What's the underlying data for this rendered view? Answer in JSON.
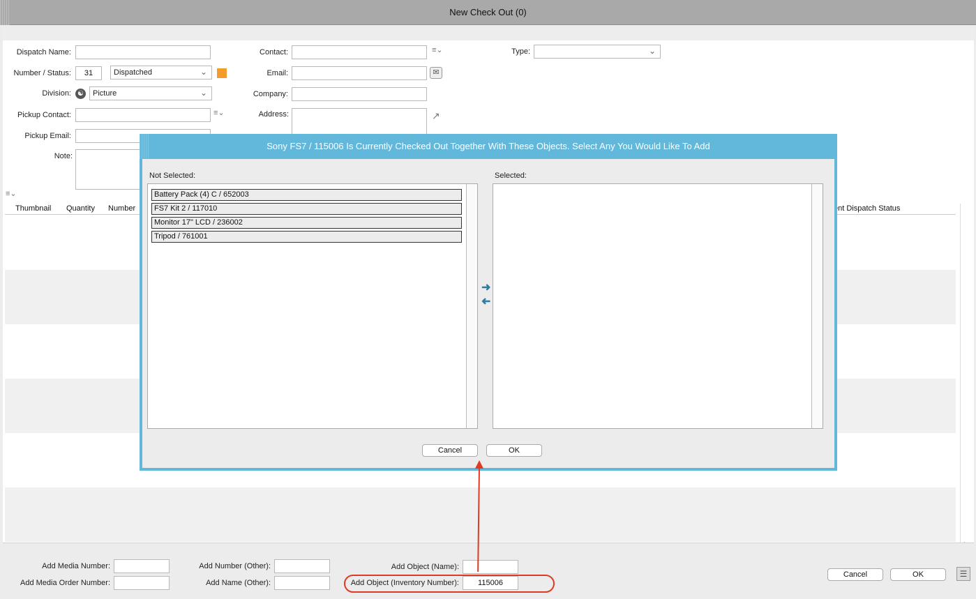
{
  "window": {
    "title": "New Check Out (0)"
  },
  "form": {
    "dispatch_name_label": "Dispatch Name:",
    "dispatch_name_value": "",
    "number_status_label": "Number / Status:",
    "number_value": "31",
    "status_value": "Dispatched",
    "status_color": "#f39c2b",
    "division_label": "Division:",
    "division_value": "Picture",
    "pickup_contact_label": "Pickup Contact:",
    "pickup_email_label": "Pickup Email:",
    "note_label": "Note:",
    "contact_label": "Contact:",
    "email_label": "Email:",
    "company_label": "Company:",
    "address_label": "Address:",
    "type_label": "Type:",
    "type_value": ""
  },
  "grid": {
    "columns": [
      "Thumbnail",
      "Quantity",
      "Number",
      "ent Dispatch Status"
    ]
  },
  "footer": {
    "add_media_number_label": "Add Media Number:",
    "add_media_order_number_label": "Add Media Order Number:",
    "add_number_other_label": "Add Number (Other):",
    "add_name_other_label": "Add Name (Other):",
    "add_object_name_label": "Add Object (Name):",
    "add_object_inventory_label": "Add Object (Inventory Number):",
    "add_object_inventory_value": "115006",
    "cancel_label": "Cancel",
    "ok_label": "OK"
  },
  "modal": {
    "title": "Sony FS7 / 115006 Is Currently Checked Out Together With These Objects. Select Any You Would Like To Add",
    "not_selected_label": "Not Selected:",
    "selected_label": "Selected:",
    "not_selected_items": [
      "Battery Pack (4) C / 652003",
      "FS7 Kit 2 / 117010",
      "Monitor 17\" LCD / 236002",
      "Tripod / 761001"
    ],
    "cancel_label": "Cancel",
    "ok_label": "OK",
    "accent_color": "#62b8da"
  },
  "annotation": {
    "highlight_color": "#e03a22"
  }
}
